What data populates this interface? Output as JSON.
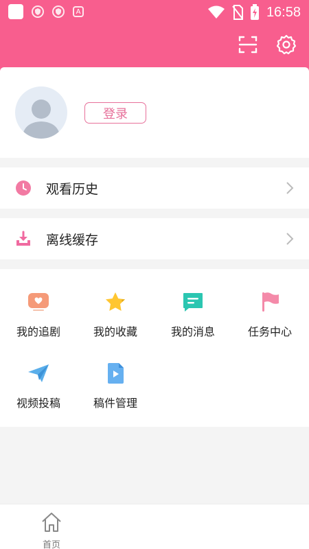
{
  "statusbar": {
    "time": "16:58",
    "badge_letter": "A"
  },
  "login": {
    "button_label": "登录"
  },
  "menu_rows": [
    {
      "label": "观看历史"
    },
    {
      "label": "离线缓存"
    }
  ],
  "grid_items": [
    {
      "label": "我的追剧"
    },
    {
      "label": "我的收藏"
    },
    {
      "label": "我的消息"
    },
    {
      "label": "任务中心"
    },
    {
      "label": "视频投稿"
    },
    {
      "label": "稿件管理"
    }
  ],
  "tabbar": {
    "home_label": "首页"
  },
  "colors": {
    "accent": "#f85e8e",
    "login_border": "#e7709a"
  }
}
